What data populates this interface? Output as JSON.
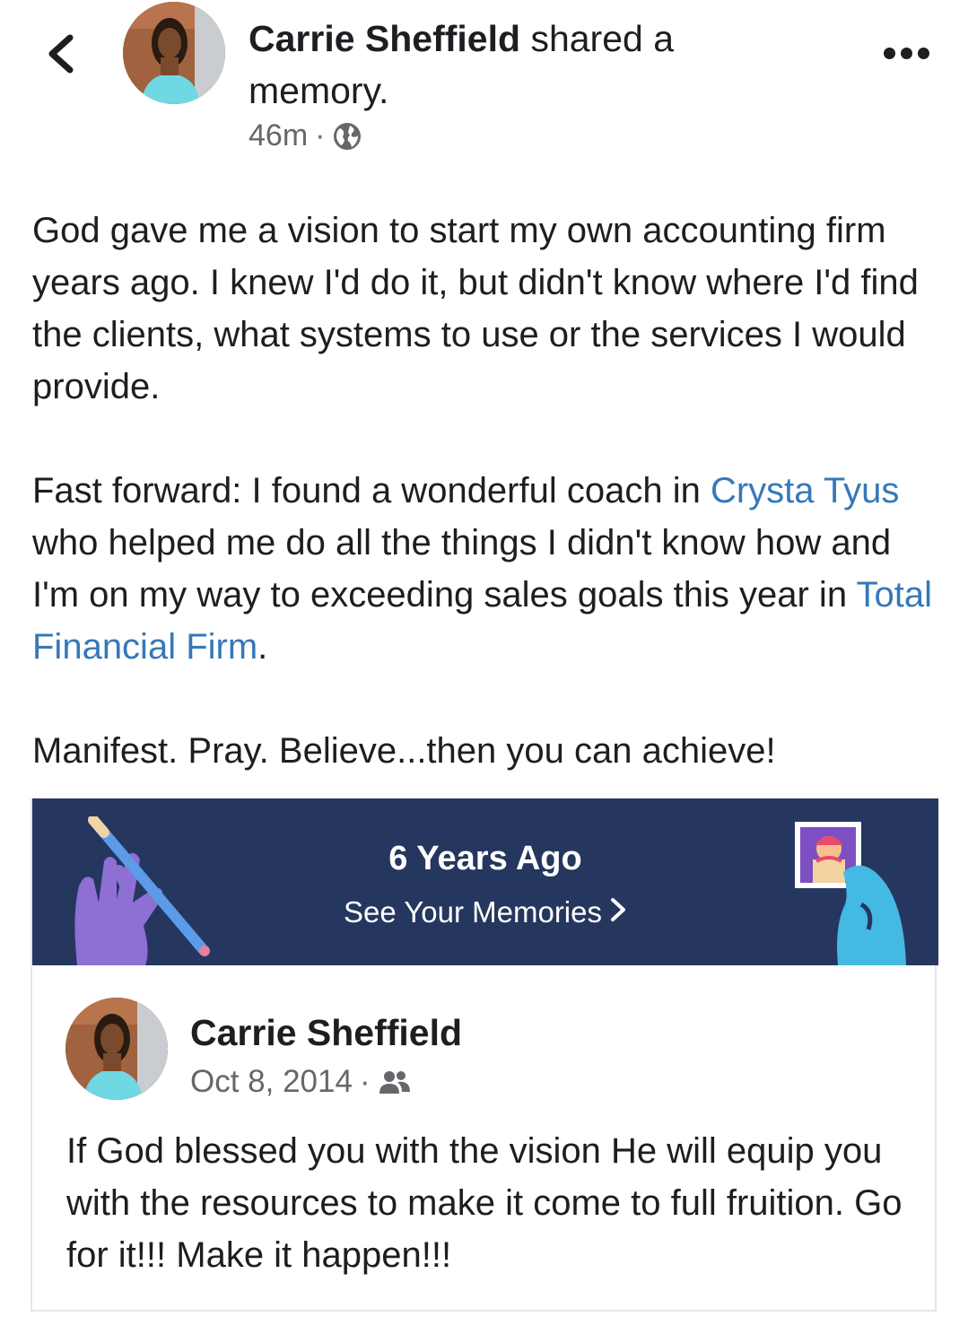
{
  "header": {
    "author": "Carrie Sheffield",
    "action_part1": "shared a",
    "action_part2": "memory.",
    "time": "46m",
    "separator": "·",
    "privacy_icon": "globe-icon",
    "back_icon": "chevron-left-icon",
    "more_icon": "more-horizontal-icon"
  },
  "post": {
    "p1": "God gave me a vision to start my own accounting firm years ago.  I knew I'd do it, but didn't know where I'd find the clients, what systems to use or the services I would provide.",
    "p2_a": "Fast forward: I found a wonderful coach in ",
    "p2_link1": "Crysta Tyus",
    "p2_b": " who helped me do all the things I didn't know how and I'm on my way to exceeding sales goals this year in ",
    "p2_link2": "Total Financial Firm",
    "p2_c": ".",
    "p3": "Manifest.  Pray.  Believe...then you can achieve!"
  },
  "memory": {
    "title": "6 Years Ago",
    "link_label": "See Your Memories",
    "link_chevron": "›",
    "colors": {
      "banner": "#25375f",
      "left_hand": "#8e6fd4",
      "right_hand": "#44b9e3",
      "link": "#3578b9"
    },
    "shared_author": "Carrie Sheffield",
    "shared_date": "Oct 8, 2014",
    "separator": "·",
    "audience_icon": "friends-icon",
    "shared_text": "If God blessed you with the vision He will equip you with the resources to make it come to full fruition.  Go for it!!!  Make it happen!!!"
  }
}
